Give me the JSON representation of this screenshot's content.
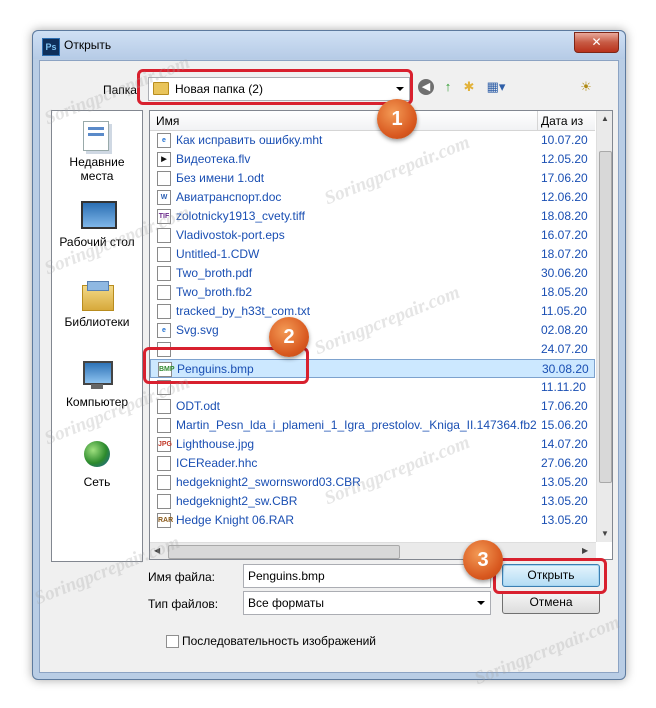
{
  "window": {
    "title": "Открыть",
    "app_icon": "Ps"
  },
  "toolbar": {
    "folder_label": "Папка:",
    "current_folder": "Новая папка (2)"
  },
  "places": [
    {
      "label": "Недавние места",
      "icon": "recent-places-icon"
    },
    {
      "label": "Рабочий стол",
      "icon": "desktop-icon"
    },
    {
      "label": "Библиотеки",
      "icon": "libraries-icon"
    },
    {
      "label": "Компьютер",
      "icon": "computer-icon"
    },
    {
      "label": "Сеть",
      "icon": "network-icon"
    }
  ],
  "columns": {
    "name": "Имя",
    "date": "Дата из"
  },
  "files": [
    {
      "name": "Как исправить ошибку.mht",
      "date": "10.07.20",
      "icon": "e"
    },
    {
      "name": "Видеотека.flv",
      "date": "12.05.20",
      "icon": "▶"
    },
    {
      "name": "Без имени 1.odt",
      "date": "17.06.20",
      "icon": ""
    },
    {
      "name": "Авиатранспорт.doc",
      "date": "12.06.20",
      "icon": "W"
    },
    {
      "name": "zolotnicky1913_cvety.tiff",
      "date": "18.08.20",
      "icon": "TIF"
    },
    {
      "name": "Vladivostok-port.eps",
      "date": "16.07.20",
      "icon": ""
    },
    {
      "name": "Untitled-1.CDW",
      "date": "18.07.20",
      "icon": ""
    },
    {
      "name": "Two_broth.pdf",
      "date": "30.06.20",
      "icon": ""
    },
    {
      "name": "Two_broth.fb2",
      "date": "18.05.20",
      "icon": ""
    },
    {
      "name": "tracked_by_h33t_com.txt",
      "date": "11.05.20",
      "icon": ""
    },
    {
      "name": "Svg.svg",
      "date": "02.08.20",
      "icon": "e"
    },
    {
      "name": "",
      "date": "24.07.20",
      "icon": ""
    },
    {
      "name": "Penguins.bmp",
      "date": "30.08.20",
      "icon": "BMP"
    },
    {
      "name": "",
      "date": "11.11.20",
      "icon": ""
    },
    {
      "name": "ODT.odt",
      "date": "17.06.20",
      "icon": ""
    },
    {
      "name": "Martin_Pesn_lda_i_plameni_1_Igra_prestolov._Kniga_II.147364.fb2",
      "date": "15.06.20",
      "icon": ""
    },
    {
      "name": "Lighthouse.jpg",
      "date": "14.07.20",
      "icon": "JPG"
    },
    {
      "name": "ICEReader.hhc",
      "date": "27.06.20",
      "icon": ""
    },
    {
      "name": "hedgeknight2_swornsword03.CBR",
      "date": "13.05.20",
      "icon": ""
    },
    {
      "name": "hedgeknight2_sw.CBR",
      "date": "13.05.20",
      "icon": ""
    },
    {
      "name": "Hedge Knight 06.RAR",
      "date": "13.05.20",
      "icon": "RAR"
    }
  ],
  "form": {
    "filename_label": "Имя файла:",
    "filename_value": "Penguins.bmp",
    "filetype_label": "Тип файлов:",
    "filetype_value": "Все форматы",
    "open_button": "Открыть",
    "cancel_button": "Отмена",
    "sequence_label": "Последовательность изображений"
  },
  "annotations": [
    "1",
    "2",
    "3"
  ],
  "watermark": "Soringpcrepair.com",
  "colors": {
    "accent_red": "#d8202e",
    "badge_orange": "#e06a2a",
    "selection": "#cce8ff",
    "link_blue": "#1a4fb3"
  }
}
